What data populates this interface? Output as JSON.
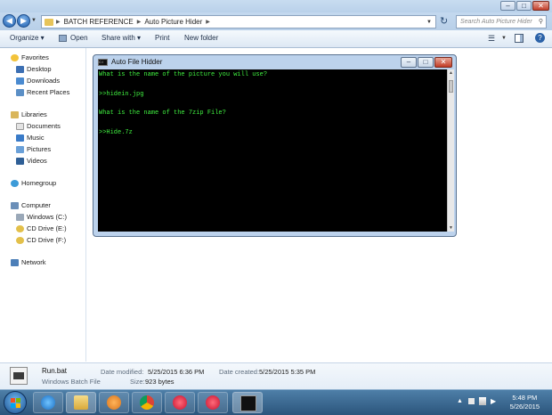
{
  "explorer": {
    "breadcrumb": [
      "BATCH REFERENCE",
      "Auto Picture Hider"
    ],
    "search_placeholder": "Search Auto Picture Hider",
    "toolbar": {
      "organize": "Organize ▾",
      "open": "Open",
      "share_with": "Share with ▾",
      "print": "Print",
      "new_folder": "New folder"
    },
    "nav": {
      "favorites": "Favorites",
      "desktop": "Desktop",
      "downloads": "Downloads",
      "recent": "Recent Places",
      "libraries": "Libraries",
      "documents": "Documents",
      "music": "Music",
      "pictures": "Pictures",
      "videos": "Videos",
      "homegroup": "Homegroup",
      "computer": "Computer",
      "windows_c": "Windows (C:)",
      "cd_e": "CD Drive (E:)",
      "cd_f": "CD Drive (F:)",
      "network": "Network"
    },
    "details": {
      "filename": "Run.bat",
      "filetype": "Windows Batch File",
      "modified_label": "Date modified:",
      "modified_value": "5/25/2015 6:36 PM",
      "created_label": "Date created:",
      "created_value": "5/25/2015 5:35 PM",
      "size_label": "Size:",
      "size_value": "923 bytes"
    }
  },
  "console": {
    "title": "Auto File Hidder",
    "lines": [
      "What is the name of the picture you will use?",
      ">>hidein.jpg",
      "What is the name of the 7zip File?",
      ">>Hide.7z"
    ],
    "text_color": "#40f040"
  },
  "taskbar": {
    "time": "5:48 PM",
    "date": "5/26/2015"
  }
}
